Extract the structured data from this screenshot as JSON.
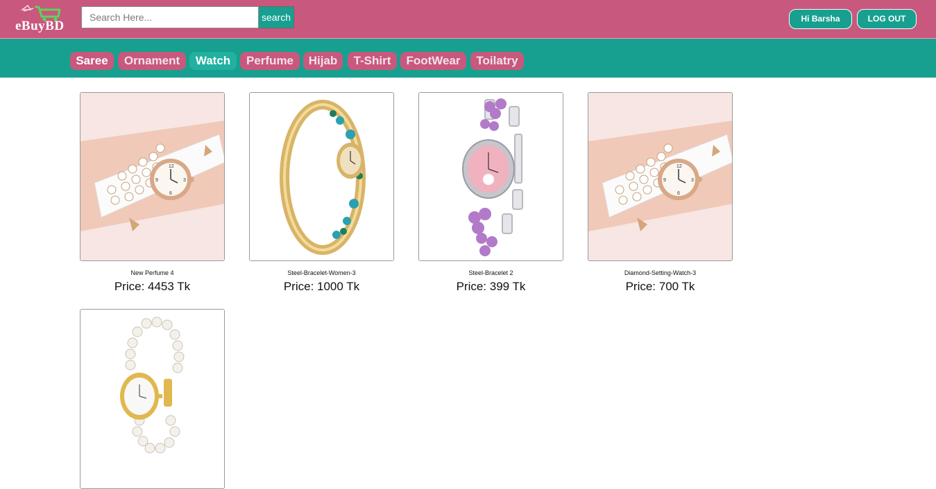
{
  "brand": {
    "name": "eBuyBD"
  },
  "search": {
    "placeholder": "Search Here...",
    "value": "",
    "button_label": "search"
  },
  "user": {
    "greeting": "Hi Barsha",
    "logout_label": "LOG OUT"
  },
  "categories": [
    {
      "label": "Saree"
    },
    {
      "label": "Ornament"
    },
    {
      "label": "Watch",
      "active": true
    },
    {
      "label": "Perfume"
    },
    {
      "label": "Hijab"
    },
    {
      "label": "T-Shirt"
    },
    {
      "label": "FootWear"
    },
    {
      "label": "Toilatry"
    }
  ],
  "products": [
    {
      "name": "New Perfume 4",
      "price": "Price: 4453 Tk",
      "image": "diamond-wrap-watch-image"
    },
    {
      "name": "Steel-Bracelet-Women-3",
      "price": "Price: 1000 Tk",
      "image": "crystal-bangle-watch-image"
    },
    {
      "name": "Steel-Bracelet 2",
      "price": "Price: 399 Tk",
      "image": "clover-bracelet-watch-image"
    },
    {
      "name": "Diamond-Setting-Watch-3",
      "price": "Price: 700 Tk",
      "image": "diamond-wrap-watch-image"
    },
    {
      "name": "",
      "price": "",
      "image": "pearl-bracelet-watch-image"
    }
  ],
  "colors": {
    "header": "#c8587d",
    "nav": "#17a090",
    "accent": "#22b0a0"
  }
}
